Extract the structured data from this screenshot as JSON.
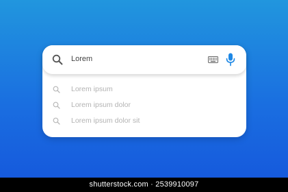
{
  "search": {
    "query": "Lorem",
    "icons": {
      "search": "search-icon",
      "keyboard": "keyboard-icon",
      "voice": "microphone-icon"
    },
    "suggestions": [
      {
        "label": "Lorem ipsum"
      },
      {
        "label": "Lorem ipsum dolor"
      },
      {
        "label": "Lorem ipsum dolor sit"
      }
    ]
  },
  "colors": {
    "accent_mic": "#1e88e5",
    "background_top": "#2196de",
    "background_bottom": "#1556dc",
    "suggestion_text": "#b3b3b3"
  },
  "watermark": {
    "text": "shutterstock.com · 2539910097"
  }
}
